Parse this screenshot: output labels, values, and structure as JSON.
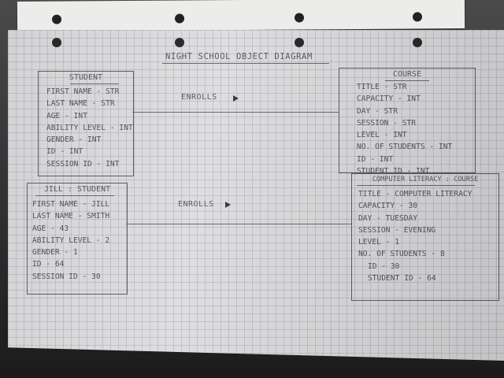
{
  "diagram": {
    "title": "NIGHT SCHOOL OBJECT DIAGRAM",
    "student_class": {
      "name": "STUDENT",
      "attributes": [
        "FIRST NAME - STR",
        "LAST NAME - STR",
        "AGE - INT",
        "ABILITY LEVEL - INT",
        "GENDER - INT",
        "ID - INT",
        "SESSION ID - INT"
      ]
    },
    "course_class": {
      "name": "COURSE",
      "attributes": [
        "TITLE - STR",
        "CAPACITY - INT",
        "DAY - STR",
        "SESSION - STR",
        "LEVEL - INT",
        "NO. OF STUDENTS - INT",
        "ID - INT",
        "STUDENT ID - INT"
      ]
    },
    "student_object": {
      "name": "JILL : STUDENT",
      "attributes": [
        "FIRST NAME - JILL",
        "LAST NAME - SMITH",
        "AGE - 43",
        "ABILITY LEVEL - 2",
        "GENDER - 1",
        "ID - 64",
        "SESSION ID - 30"
      ]
    },
    "course_object": {
      "name": "COMPUTER LITERACY : COURSE",
      "attributes": [
        "TITLE - COMPUTER LITERACY",
        "CAPACITY - 30",
        "DAY - TUESDAY",
        "SESSION - EVENING",
        "LEVEL - 1",
        "NO. OF STUDENTS - 8",
        "ID - 30",
        "STUDENT ID - 64"
      ]
    },
    "relationships": [
      {
        "label": "ENROLLS",
        "from": "STUDENT",
        "to": "COURSE"
      },
      {
        "label": "ENROLLS",
        "from": "JILL : STUDENT",
        "to": "COMPUTER LITERACY : COURSE"
      }
    ]
  }
}
